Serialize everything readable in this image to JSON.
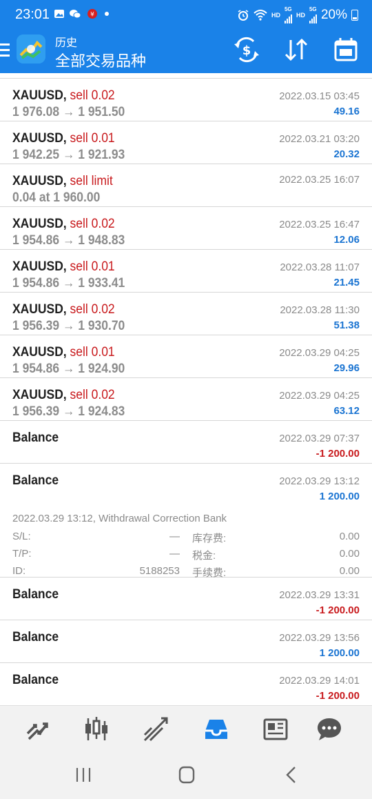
{
  "status_bar": {
    "time": "23:01",
    "battery": "20%",
    "net1": "HD",
    "net2": "5G",
    "net3": "HD",
    "net4": "5G"
  },
  "header": {
    "subtitle": "历史",
    "title": "全部交易品种",
    "actions": [
      "currency-exchange-icon",
      "sort-icon",
      "calendar-icon"
    ]
  },
  "trades": [
    {
      "symbol": "XAUUSD,",
      "type": "sell 0.02",
      "prices": "1 976.08 → 1 951.50",
      "time": "2022.03.15 03:45",
      "profit": "49.16"
    },
    {
      "symbol": "XAUUSD,",
      "type": "sell 0.01",
      "prices": "1 942.25 → 1 921.93",
      "time": "2022.03.21 03:20",
      "profit": "20.32"
    },
    {
      "symbol": "XAUUSD,",
      "type": "sell limit",
      "prices": "0.04 at 1 960.00",
      "time": "2022.03.25 16:07",
      "profit": ""
    },
    {
      "symbol": "XAUUSD,",
      "type": "sell 0.02",
      "prices": "1 954.86 → 1 948.83",
      "time": "2022.03.25 16:47",
      "profit": "12.06"
    },
    {
      "symbol": "XAUUSD,",
      "type": "sell 0.01",
      "prices": "1 954.86 → 1 933.41",
      "time": "2022.03.28 11:07",
      "profit": "21.45"
    },
    {
      "symbol": "XAUUSD,",
      "type": "sell 0.02",
      "prices": "1 956.39 → 1 930.70",
      "time": "2022.03.28 11:30",
      "profit": "51.38"
    },
    {
      "symbol": "XAUUSD,",
      "type": "sell 0.01",
      "prices": "1 954.86 → 1 924.90",
      "time": "2022.03.29 04:25",
      "profit": "29.96"
    },
    {
      "symbol": "XAUUSD,",
      "type": "sell 0.02",
      "prices": "1 956.39 → 1 924.83",
      "time": "2022.03.29 04:25",
      "profit": "63.12"
    }
  ],
  "balances": [
    {
      "label": "Balance",
      "time": "2022.03.29 07:37",
      "amount": "-1 200.00"
    },
    {
      "label": "Balance",
      "time": "2022.03.29 13:12",
      "amount": "1 200.00"
    },
    {
      "label": "Balance",
      "time": "2022.03.29 13:31",
      "amount": "-1 200.00"
    },
    {
      "label": "Balance",
      "time": "2022.03.29 13:56",
      "amount": "1 200.00"
    },
    {
      "label": "Balance",
      "time": "2022.03.29 14:01",
      "amount": "-1 200.00"
    }
  ],
  "detail": {
    "comment": "2022.03.29 13:12, Withdrawal Correction Bank",
    "sl_label": "S/L:",
    "sl_value": "—",
    "tp_label": "T/P:",
    "tp_value": "—",
    "id_label": "ID:",
    "id_value": "5188253",
    "swap_label": "库存费:",
    "swap_value": "0.00",
    "tax_label": "税金:",
    "tax_value": "0.00",
    "fee_label": "手续费:",
    "fee_value": "0.00"
  },
  "bottom_nav": [
    "quotes-icon",
    "chart-icon",
    "trade-icon",
    "history-icon",
    "news-icon",
    "chat-icon"
  ],
  "colors": {
    "header_bg": "#1a82e8",
    "sell": "#c8191c",
    "profit_positive": "#1a74d2",
    "profit_negative": "#c8191c",
    "active_tab": "#1a82e8"
  }
}
